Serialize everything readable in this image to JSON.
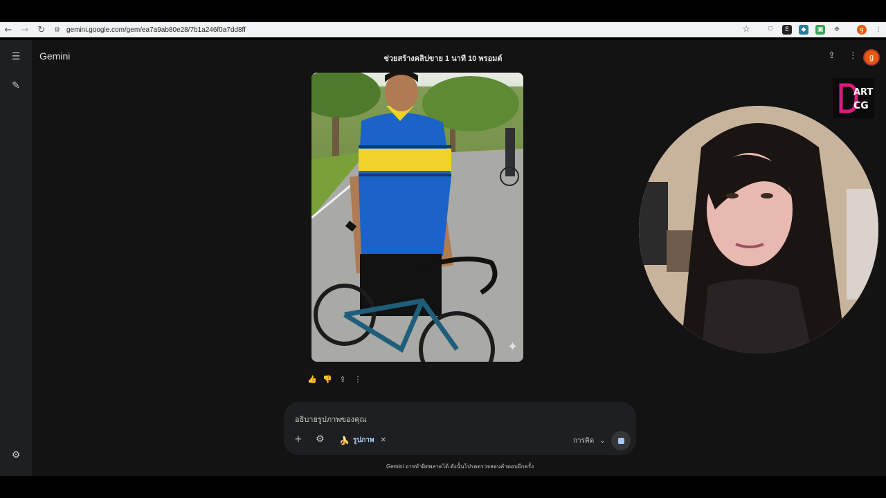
{
  "browser": {
    "back_icon": "arrow-left-icon",
    "forward_icon": "arrow-right-icon",
    "reload_icon": "reload-icon",
    "url": "gemini.google.com/gem/ea7a9ab80e28/7b1a246f0a7dd8ff",
    "profile_initial": "g"
  },
  "app": {
    "brand": "Gemini",
    "conversation_title": "ช่วยสร้างคลิปขาย 1 นาที 10 พรอมต์",
    "user_initial": "g"
  },
  "composer": {
    "placeholder": "อธิบายรูปภาพของคุณ",
    "tool_chip_label": "รูปภาพ",
    "mode_label": "การคิด"
  },
  "disclaimer": "Gemini อาจทำผิดพลาดได้ ดังนั้นโปรดตรวจสอบคำตอบอีกครั้ง",
  "colors": {
    "app_bg": "#131314",
    "rail_bg": "#1e1f20",
    "composer_bg": "#1e1f20",
    "accent": "#a8c7fa",
    "avatar": "#e8590c",
    "logo_pink": "#e0197d"
  }
}
